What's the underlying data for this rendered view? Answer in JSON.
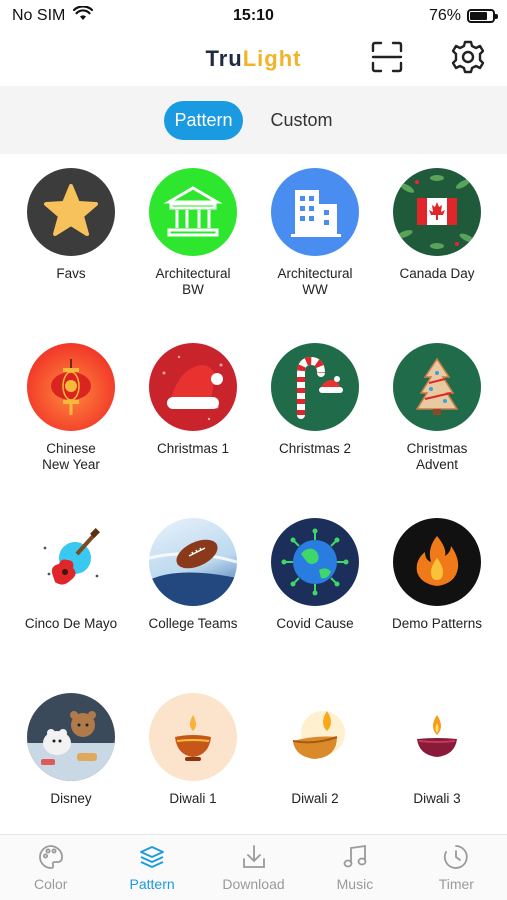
{
  "status_bar": {
    "carrier": "No SIM",
    "time": "15:10",
    "battery_text": "76%",
    "battery_level": 0.76
  },
  "header": {
    "logo_part1": "Tru",
    "logo_part2": "Light",
    "scan_icon": "scan-icon",
    "settings_icon": "gear-icon"
  },
  "segments": [
    {
      "label": "Pattern",
      "active": true
    },
    {
      "label": "Custom",
      "active": false
    }
  ],
  "patterns": [
    {
      "label": "Favs",
      "icon": "star-icon"
    },
    {
      "label": "Architectural\nBW",
      "icon": "building-columns-icon"
    },
    {
      "label": "Architectural\nWW",
      "icon": "office-building-icon"
    },
    {
      "label": "Canada Day",
      "icon": "canada-flag-icon"
    },
    {
      "label": "Chinese\nNew Year",
      "icon": "lantern-icon"
    },
    {
      "label": "Christmas 1",
      "icon": "santa-hat-icon"
    },
    {
      "label": "Christmas 2",
      "icon": "candy-cane-icon"
    },
    {
      "label": "Christmas\nAdvent",
      "icon": "christmas-tree-icon"
    },
    {
      "label": "Cinco De Mayo",
      "icon": "guitar-icon"
    },
    {
      "label": "College Teams",
      "icon": "football-icon"
    },
    {
      "label": "Covid Cause",
      "icon": "virus-globe-icon"
    },
    {
      "label": "Demo Patterns",
      "icon": "flame-icon"
    },
    {
      "label": "Disney",
      "icon": "cartoon-bears-icon"
    },
    {
      "label": "Diwali 1",
      "icon": "diya-lamp-icon"
    },
    {
      "label": "Diwali 2",
      "icon": "oil-lamp-icon"
    },
    {
      "label": "Diwali 3",
      "icon": "diya-lamp-icon"
    }
  ],
  "tabs": [
    {
      "label": "Color",
      "icon": "palette-icon",
      "active": false
    },
    {
      "label": "Pattern",
      "icon": "layers-icon",
      "active": true
    },
    {
      "label": "Download",
      "icon": "download-icon",
      "active": false
    },
    {
      "label": "Music",
      "icon": "music-note-icon",
      "active": false
    },
    {
      "label": "Timer",
      "icon": "clock-icon",
      "active": false
    }
  ],
  "colors": {
    "accent": "#1a9ae0",
    "logo_dark": "#1f2a44",
    "logo_gold": "#f0b429",
    "inactive_tab": "#9a9a9a"
  }
}
